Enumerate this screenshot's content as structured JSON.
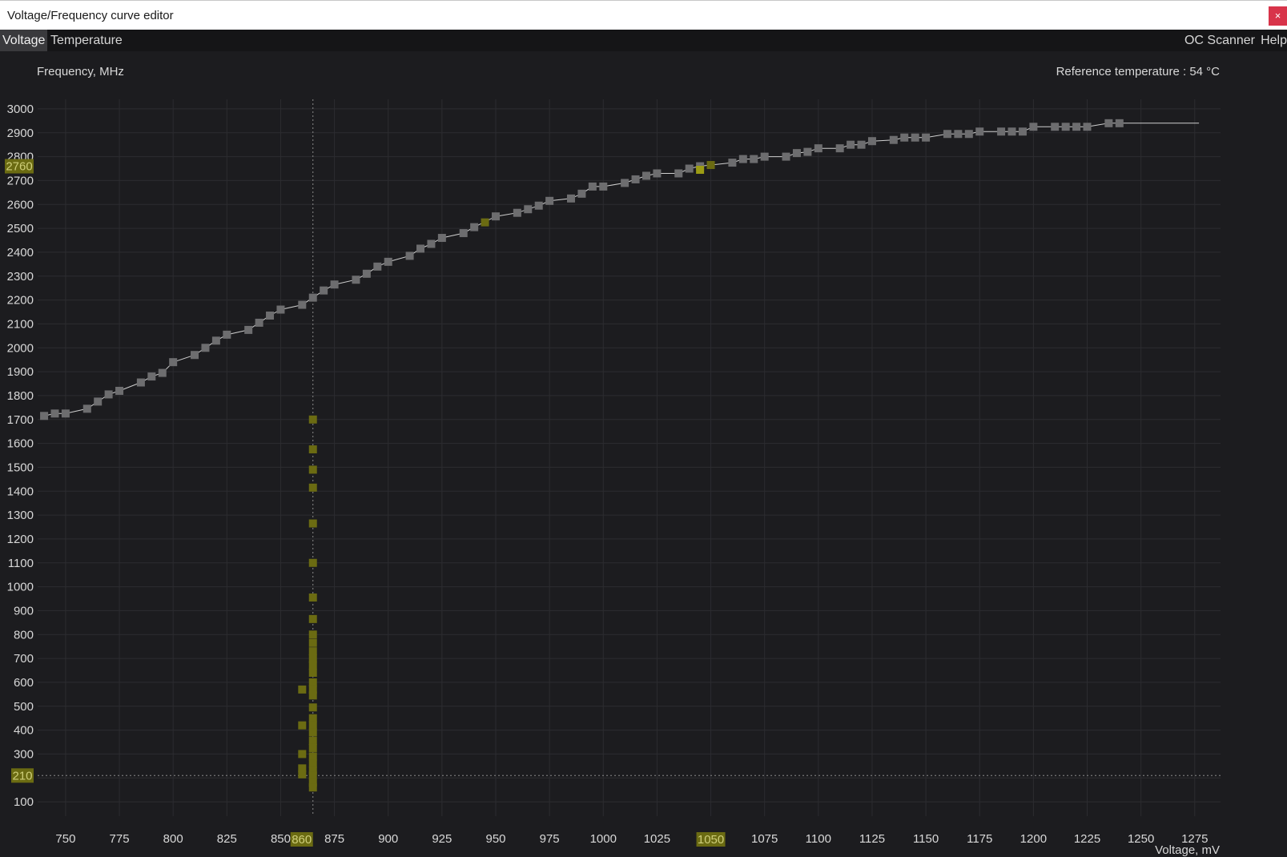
{
  "window": {
    "title": "Voltage/Frequency curve editor",
    "close_label": "×"
  },
  "menu": {
    "left": [
      "Voltage",
      "Temperature"
    ],
    "right": [
      "OC Scanner",
      "Help"
    ]
  },
  "chart_header": {
    "ylabel": "Frequency, MHz",
    "reference_temperature": "Reference temperature : 54 °C"
  },
  "colors": {
    "background": "#1c1c1f",
    "grid": "#2c2c30",
    "curve_point": "#6d6d6f",
    "curve_line": "#cfcfcf",
    "highlight": "#6b6b12",
    "highlight_bright": "#9c9c14",
    "highlight_text": "#cfcf7a"
  },
  "chart_data": {
    "type": "scatter",
    "xlabel": "Voltage, mV",
    "ylabel": "Frequency, MHz",
    "x_ticks": [
      750,
      775,
      800,
      825,
      850,
      875,
      900,
      925,
      950,
      975,
      1000,
      1025,
      1075,
      1100,
      1125,
      1150,
      1175,
      1200,
      1225,
      1250,
      1275
    ],
    "y_ticks": [
      100,
      300,
      400,
      500,
      600,
      700,
      800,
      900,
      1000,
      1100,
      1200,
      1300,
      1400,
      1500,
      1600,
      1700,
      1800,
      1900,
      2000,
      2100,
      2200,
      2300,
      2400,
      2500,
      2600,
      2700,
      2800,
      2900,
      3000
    ],
    "xlim": [
      737,
      1287
    ],
    "ylim": [
      40,
      3040
    ],
    "grid": true,
    "selected_voltage": "860",
    "selected_voltage_value": 865,
    "locked_voltage": "1050",
    "locked_voltage_value": 1050,
    "selected_frequency": "2760",
    "selected_frequency_value": 2760,
    "current_frequency": "210",
    "current_frequency_value": 210,
    "curve": {
      "x": [
        740,
        745,
        750,
        760,
        765,
        770,
        775,
        785,
        790,
        795,
        800,
        810,
        815,
        820,
        825,
        835,
        840,
        845,
        850,
        860,
        865,
        870,
        875,
        885,
        890,
        895,
        900,
        910,
        915,
        920,
        925,
        935,
        940,
        950,
        960,
        965,
        970,
        975,
        985,
        990,
        995,
        1000,
        1010,
        1015,
        1020,
        1025,
        1035,
        1040,
        1045,
        1060,
        1065,
        1070,
        1075,
        1085,
        1090,
        1095,
        1100,
        1110,
        1115,
        1120,
        1125,
        1135,
        1140,
        1145,
        1150,
        1160,
        1165,
        1170,
        1175,
        1185,
        1190,
        1195,
        1200,
        1210,
        1215,
        1220,
        1225,
        1235,
        1240
      ],
      "y": [
        1715,
        1725,
        1725,
        1745,
        1775,
        1805,
        1820,
        1855,
        1880,
        1895,
        1940,
        1970,
        2000,
        2030,
        2055,
        2075,
        2105,
        2135,
        2160,
        2180,
        2210,
        2240,
        2265,
        2285,
        2310,
        2340,
        2360,
        2385,
        2415,
        2435,
        2460,
        2480,
        2505,
        2550,
        2565,
        2580,
        2595,
        2615,
        2625,
        2645,
        2675,
        2675,
        2690,
        2705,
        2720,
        2730,
        2730,
        2750,
        2760,
        2775,
        2790,
        2790,
        2800,
        2800,
        2815,
        2820,
        2835,
        2835,
        2850,
        2850,
        2865,
        2870,
        2880,
        2880,
        2880,
        2895,
        2895,
        2895,
        2905,
        2905,
        2905,
        2905,
        2925,
        2925,
        2925,
        2925,
        2925,
        2940,
        2940
      ],
      "line_end_x": 1277,
      "line_end_y": 2940
    },
    "highlight_points": [
      {
        "x": 945,
        "y": 2525
      },
      {
        "x": 1045,
        "y": 2745
      },
      {
        "x": 1050,
        "y": 2765
      }
    ],
    "distribution_points": {
      "x": [
        865,
        865,
        865,
        865,
        865,
        865,
        865,
        865,
        865,
        865,
        865,
        865,
        865,
        865,
        865,
        865,
        865,
        865,
        865,
        865,
        865,
        865,
        865,
        865,
        865,
        865,
        865,
        865,
        865,
        860,
        860,
        860,
        860,
        860
      ],
      "y": [
        1700,
        1575,
        1490,
        1415,
        1265,
        1100,
        955,
        865,
        800,
        765,
        730,
        700,
        670,
        640,
        600,
        570,
        545,
        495,
        450,
        420,
        390,
        355,
        325,
        290,
        260,
        230,
        210,
        180,
        160,
        570,
        420,
        300,
        240,
        215
      ]
    }
  }
}
